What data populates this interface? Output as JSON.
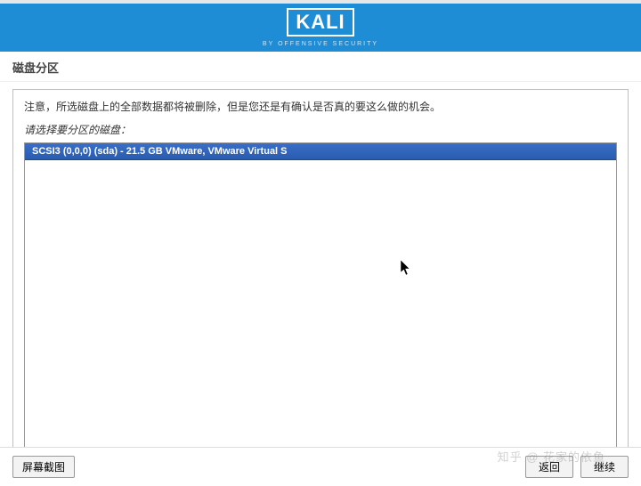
{
  "logo": {
    "text": "KALI",
    "subtitle": "BY OFFENSIVE SECURITY"
  },
  "section": {
    "title": "磁盘分区"
  },
  "main": {
    "warning": "注意，所选磁盘上的全部数据都将被删除，但是您还是有确认是否真的要这么做的机会。",
    "prompt": "请选择要分区的磁盘：",
    "disks": [
      "SCSI3 (0,0,0) (sda) - 21.5 GB VMware, VMware Virtual S"
    ]
  },
  "footer": {
    "screenshot": "屏幕截图",
    "back": "返回",
    "continue": "继续"
  },
  "watermark": "知乎 @ 花家的依鱼"
}
